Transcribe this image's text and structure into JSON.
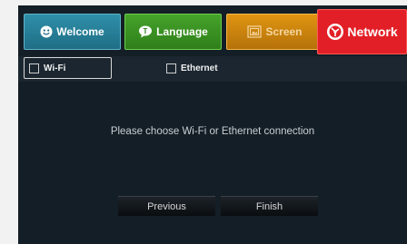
{
  "tabs": {
    "welcome": "Welcome",
    "language": "Language",
    "screen": "Screen",
    "network": "Network"
  },
  "options": {
    "wifi": "Wi-Fi",
    "ethernet": "Ethernet"
  },
  "message": "Please choose Wi-Fi or Ethernet connection",
  "buttons": {
    "previous": "Previous",
    "finish": "Finish"
  },
  "colors": {
    "welcome": "#2a86a0",
    "language": "#3f9a26",
    "screen": "#d58a10",
    "network": "#e21f26",
    "background": "#141e26"
  }
}
